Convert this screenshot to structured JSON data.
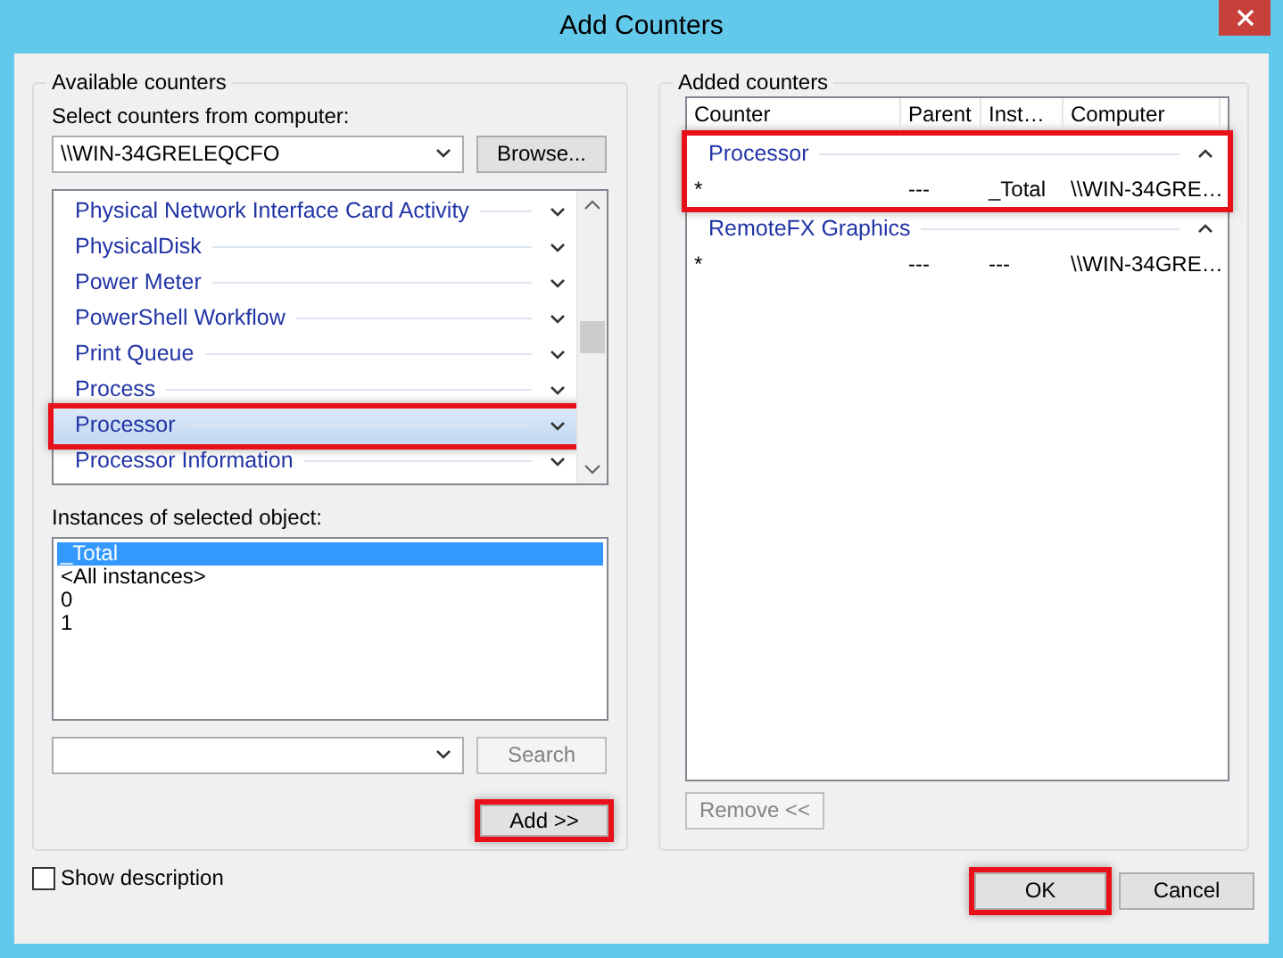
{
  "window": {
    "title": "Add Counters"
  },
  "available": {
    "legend": "Available counters",
    "computer_label": "Select counters from computer:",
    "computer": "\\\\WIN-34GRELEQCFO",
    "browse": "Browse...",
    "objects": [
      {
        "name": "Physical Network Interface Card Activity",
        "selected": false,
        "highlighted": false,
        "expanded": false
      },
      {
        "name": "PhysicalDisk",
        "selected": false,
        "highlighted": false,
        "expanded": false
      },
      {
        "name": "Power Meter",
        "selected": false,
        "highlighted": false,
        "expanded": false
      },
      {
        "name": "PowerShell Workflow",
        "selected": false,
        "highlighted": false,
        "expanded": false
      },
      {
        "name": "Print Queue",
        "selected": false,
        "highlighted": false,
        "expanded": false
      },
      {
        "name": "Process",
        "selected": false,
        "highlighted": false,
        "expanded": false
      },
      {
        "name": "Processor",
        "selected": true,
        "highlighted": true,
        "expanded": false
      },
      {
        "name": "Processor Information",
        "selected": false,
        "highlighted": false,
        "expanded": false
      }
    ],
    "instances_label": "Instances of selected object:",
    "instances": [
      {
        "name": "_Total",
        "selected": true
      },
      {
        "name": "<All instances>",
        "selected": false
      },
      {
        "name": "0",
        "selected": false
      },
      {
        "name": "1",
        "selected": false
      }
    ],
    "search_button": {
      "label": "Search",
      "disabled": true
    },
    "add_button": {
      "label": "Add >>",
      "highlighted": true
    }
  },
  "added": {
    "legend": "Added counters",
    "columns": [
      "Counter",
      "Parent",
      "Inst…",
      "Computer"
    ],
    "groups": [
      {
        "name": "Processor",
        "expanded": true,
        "highlighted": true,
        "rows": [
          {
            "counter": "*",
            "parent": "---",
            "instance": "_Total",
            "computer": "\\\\WIN-34GRE…"
          }
        ]
      },
      {
        "name": "RemoteFX Graphics",
        "expanded": true,
        "highlighted": false,
        "rows": [
          {
            "counter": "*",
            "parent": "---",
            "instance": "---",
            "computer": "\\\\WIN-34GRE…"
          }
        ]
      }
    ],
    "remove_button": {
      "label": "Remove <<",
      "disabled": true
    }
  },
  "show_description": {
    "label": "Show description",
    "checked": false
  },
  "buttons": [
    {
      "label": "OK",
      "highlighted": true
    },
    {
      "label": "Cancel",
      "highlighted": false
    }
  ]
}
